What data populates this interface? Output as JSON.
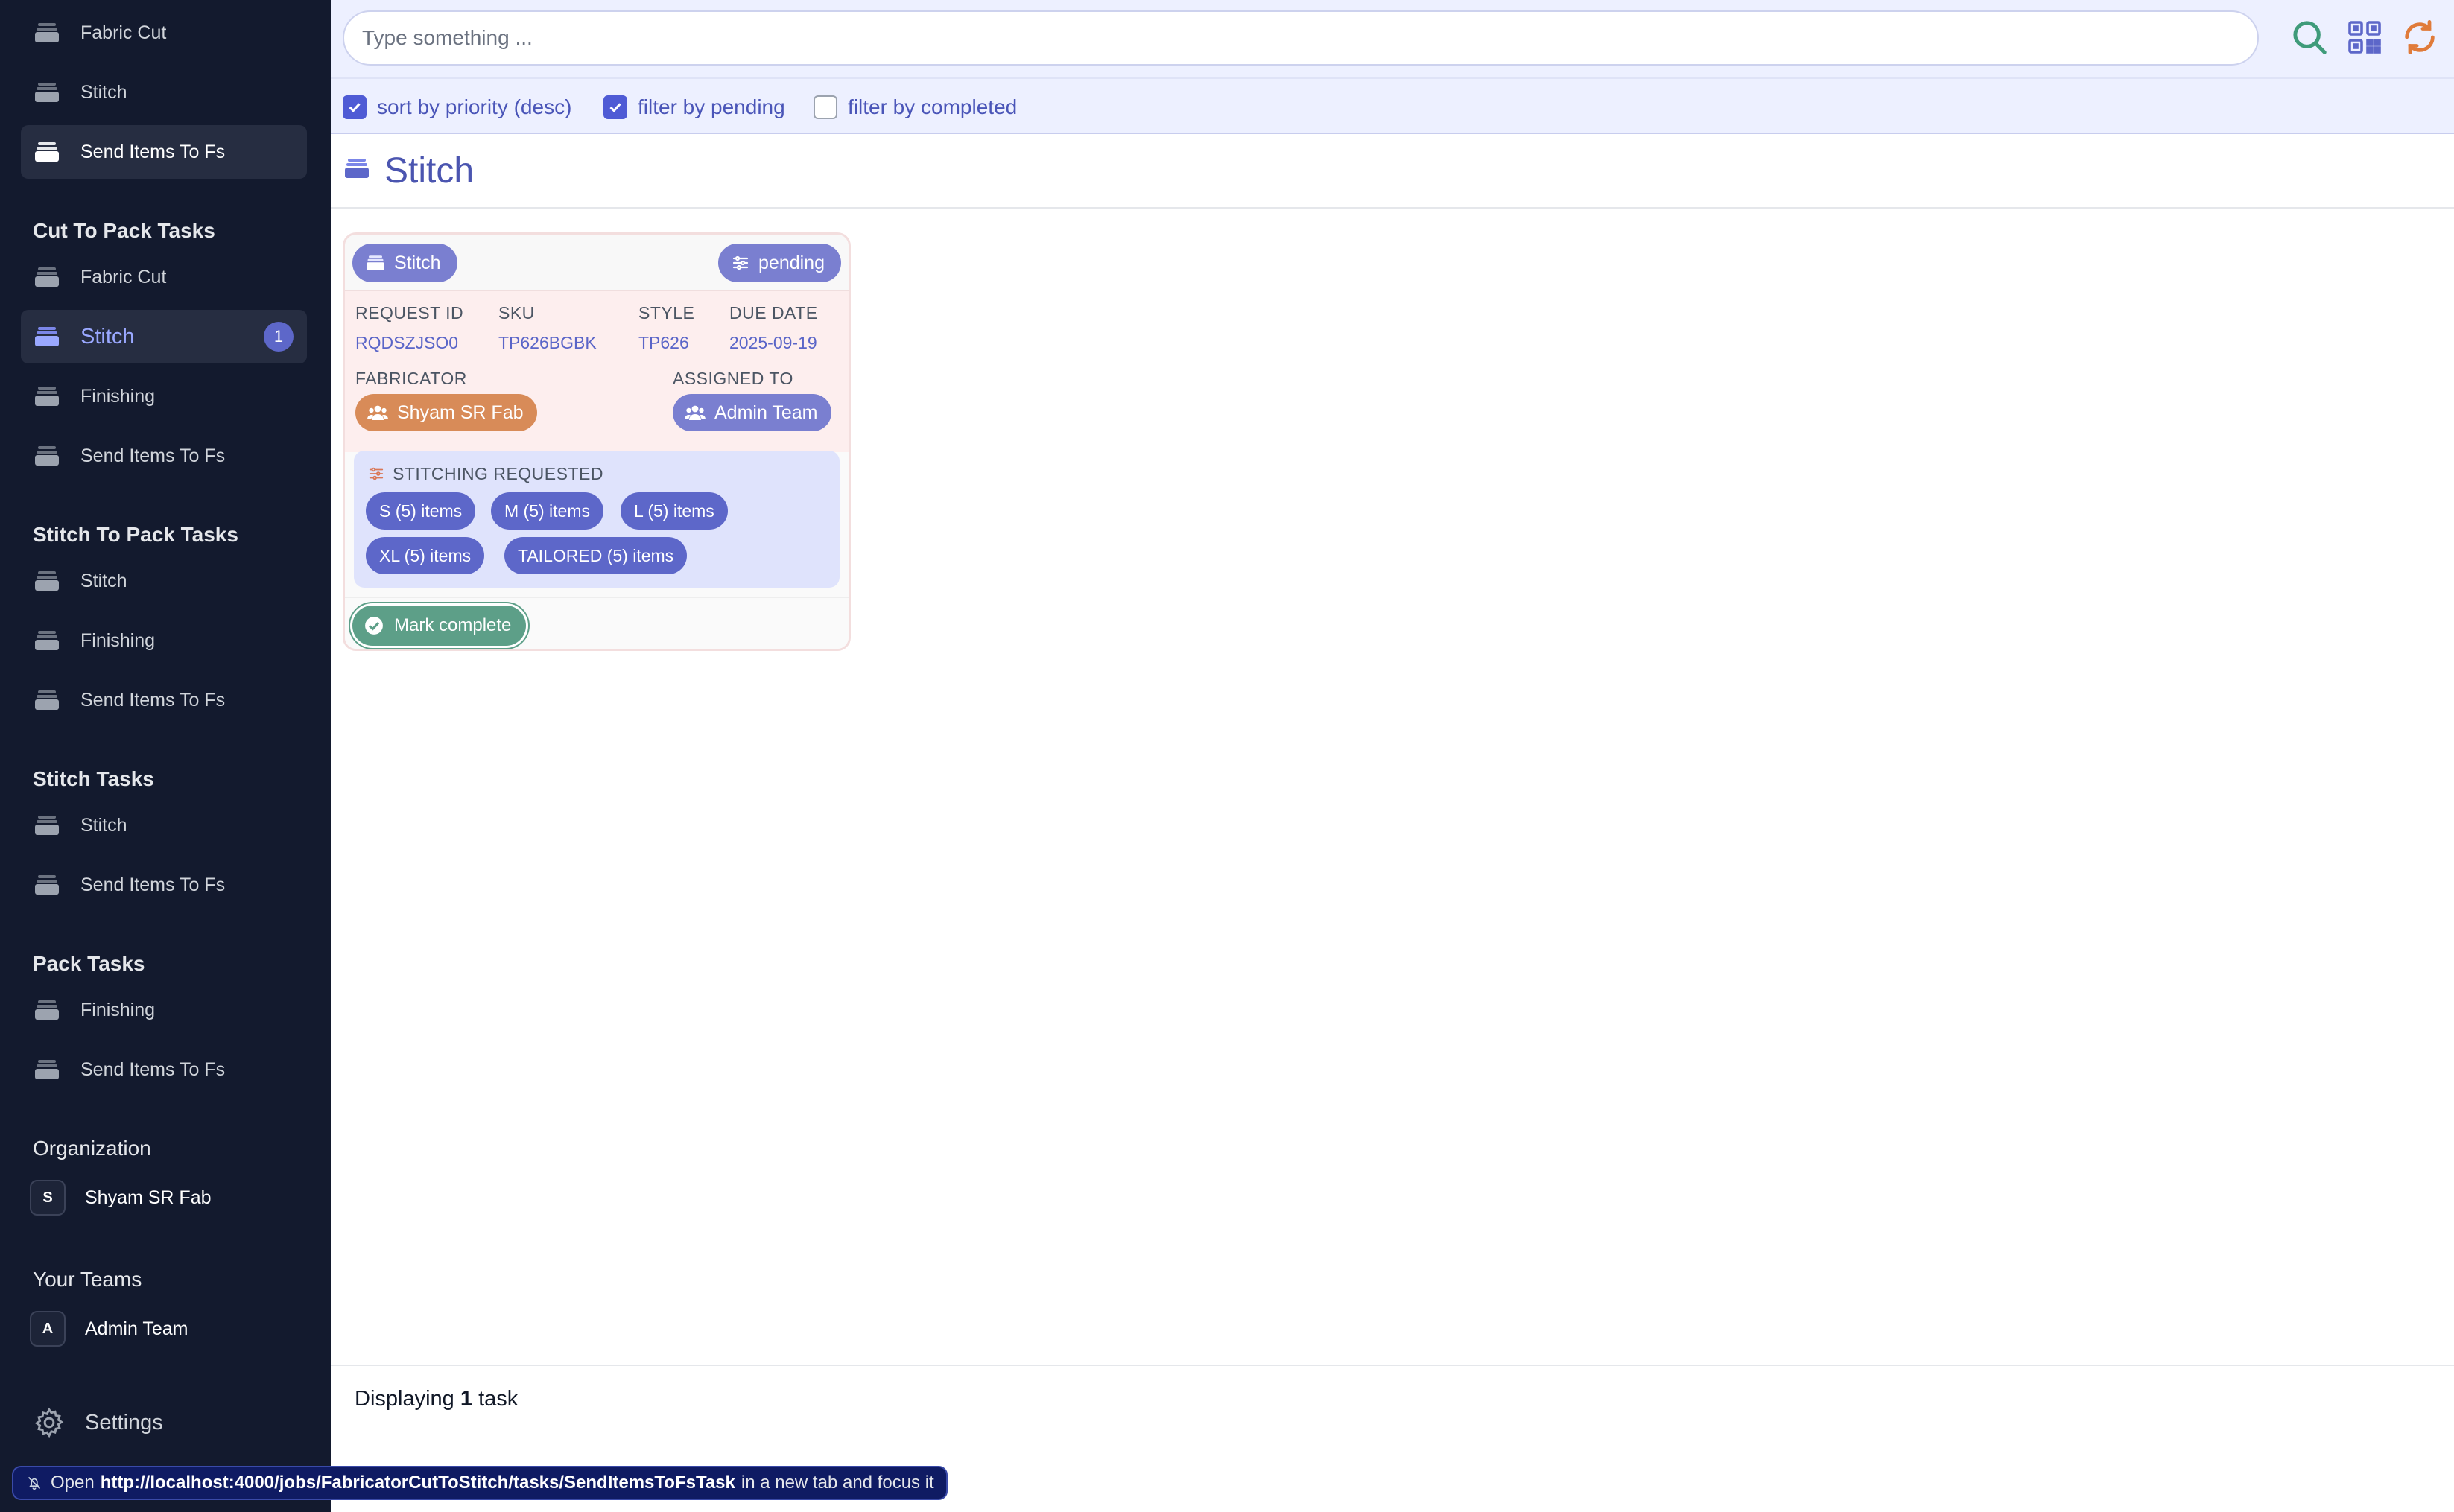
{
  "sidebar": {
    "top_items": [
      {
        "label": "Fabric Cut"
      },
      {
        "label": "Stitch"
      },
      {
        "label": "Send Items To Fs"
      }
    ],
    "sections": [
      {
        "title": "Cut To Pack Tasks",
        "items": [
          {
            "label": "Fabric Cut"
          },
          {
            "label": "Stitch",
            "badge": "1"
          },
          {
            "label": "Finishing"
          },
          {
            "label": "Send Items To Fs"
          }
        ]
      },
      {
        "title": "Stitch To Pack Tasks",
        "items": [
          {
            "label": "Stitch"
          },
          {
            "label": "Finishing"
          },
          {
            "label": "Send Items To Fs"
          }
        ]
      },
      {
        "title": "Stitch Tasks",
        "items": [
          {
            "label": "Stitch"
          },
          {
            "label": "Send Items To Fs"
          }
        ]
      },
      {
        "title": "Pack Tasks",
        "items": [
          {
            "label": "Finishing"
          },
          {
            "label": "Send Items To Fs"
          }
        ]
      }
    ],
    "organization": {
      "title": "Organization",
      "avatar": "S",
      "name": "Shyam SR Fab"
    },
    "teams": {
      "title": "Your Teams",
      "avatar": "A",
      "name": "Admin Team"
    },
    "settings_label": "Settings"
  },
  "topbar": {
    "search_placeholder": "Type something ...",
    "icons": [
      "search-icon",
      "qr-code-icon",
      "refresh-icon"
    ]
  },
  "filters": [
    {
      "label": "sort by priority (desc)",
      "checked": true
    },
    {
      "label": "filter by pending",
      "checked": true
    },
    {
      "label": "filter by completed",
      "checked": false
    }
  ],
  "page": {
    "title": "Stitch"
  },
  "task_card": {
    "type_label": "Stitch",
    "status_label": "pending",
    "fields": {
      "request_id_label": "REQUEST ID",
      "request_id": "RQDSZJSO0",
      "sku_label": "SKU",
      "sku": "TP626BGBK",
      "style_label": "STYLE",
      "style": "TP626",
      "due_date_label": "DUE DATE",
      "due_date": "2025-09-19",
      "fabricator_label": "FABRICATOR",
      "fabricator": "Shyam SR Fab",
      "assigned_label": "ASSIGNED TO",
      "assigned": "Admin Team"
    },
    "stitching": {
      "title": "STITCHING REQUESTED",
      "chips": [
        "S (5) items",
        "M (5) items",
        "L (5) items",
        "XL (5) items",
        "TAILORED (5) items"
      ]
    },
    "action_label": "Mark complete"
  },
  "footer": {
    "prefix": "Displaying",
    "count": "1",
    "suffix": "task"
  },
  "status_bar": {
    "prefix": "Open",
    "url": "http://localhost:4000/jobs/FabricatorCutToStitch/tasks/SendItemsToFsTask",
    "suffix": "in a new tab and focus it"
  },
  "colors": {
    "sidebar_bg": "#131a2e",
    "accent": "#5d67c9",
    "topbar_bg": "#edf0ff",
    "success": "#5d9f88",
    "fabricator_pill": "#d88b58"
  }
}
